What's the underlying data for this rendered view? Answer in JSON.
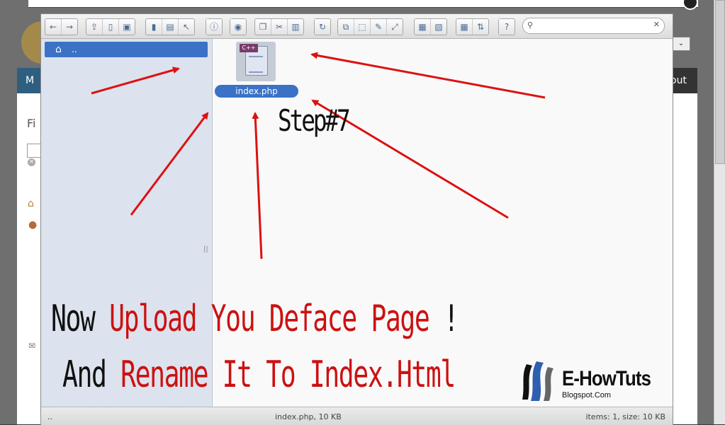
{
  "background": {
    "nav_left_label": "M",
    "nav_right_label": "out",
    "heading_label": "Fi",
    "select_arrow": "⌄",
    "icons": {
      "close": "x-circle-icon",
      "home": "house-icon",
      "user": "user-icon",
      "mail": "mail-icon"
    }
  },
  "toolbar": {
    "groups": [
      [
        "arrow-left-icon",
        "arrow-right-icon"
      ],
      [
        "upload-icon",
        "new-file-icon",
        "save-icon"
      ],
      [
        "copy-pane-icon",
        "disk-icon",
        "pointer-icon"
      ],
      [
        "info-icon"
      ],
      [
        "eye-icon"
      ],
      [
        "duplicate-icon",
        "cut-icon",
        "paste-icon"
      ],
      [
        "refresh-file-icon"
      ],
      [
        "copy-icon",
        "select-icon",
        "edit-icon",
        "resize-icon"
      ],
      [
        "archive-icon",
        "extract-icon"
      ],
      [
        "view-grid-icon",
        "view-sort-icon"
      ],
      [
        "help-icon"
      ]
    ],
    "search": {
      "value": "",
      "placeholder": ""
    }
  },
  "sidebar": {
    "root": {
      "label": "..",
      "icon": "home-icon"
    },
    "handle": "||"
  },
  "files": [
    {
      "name": "index.php",
      "type_tag": "C++",
      "icon": "cpp-file-icon"
    }
  ],
  "statusbar": {
    "path": "..",
    "selection": "index.php, 10 KB",
    "summary": "items: 1, size: 10 KB"
  },
  "overlay": {
    "step": "Step#7",
    "line1_black": "Now ",
    "line1_red": "Upload You Deface Page",
    "line1_tail": " !",
    "line2_black": "And ",
    "line2_red": "Rename It To Index.Html",
    "brand_name": "E-HowTuts",
    "brand_sub": "Blogspot.Com",
    "arrow_color": "#dd1111"
  }
}
